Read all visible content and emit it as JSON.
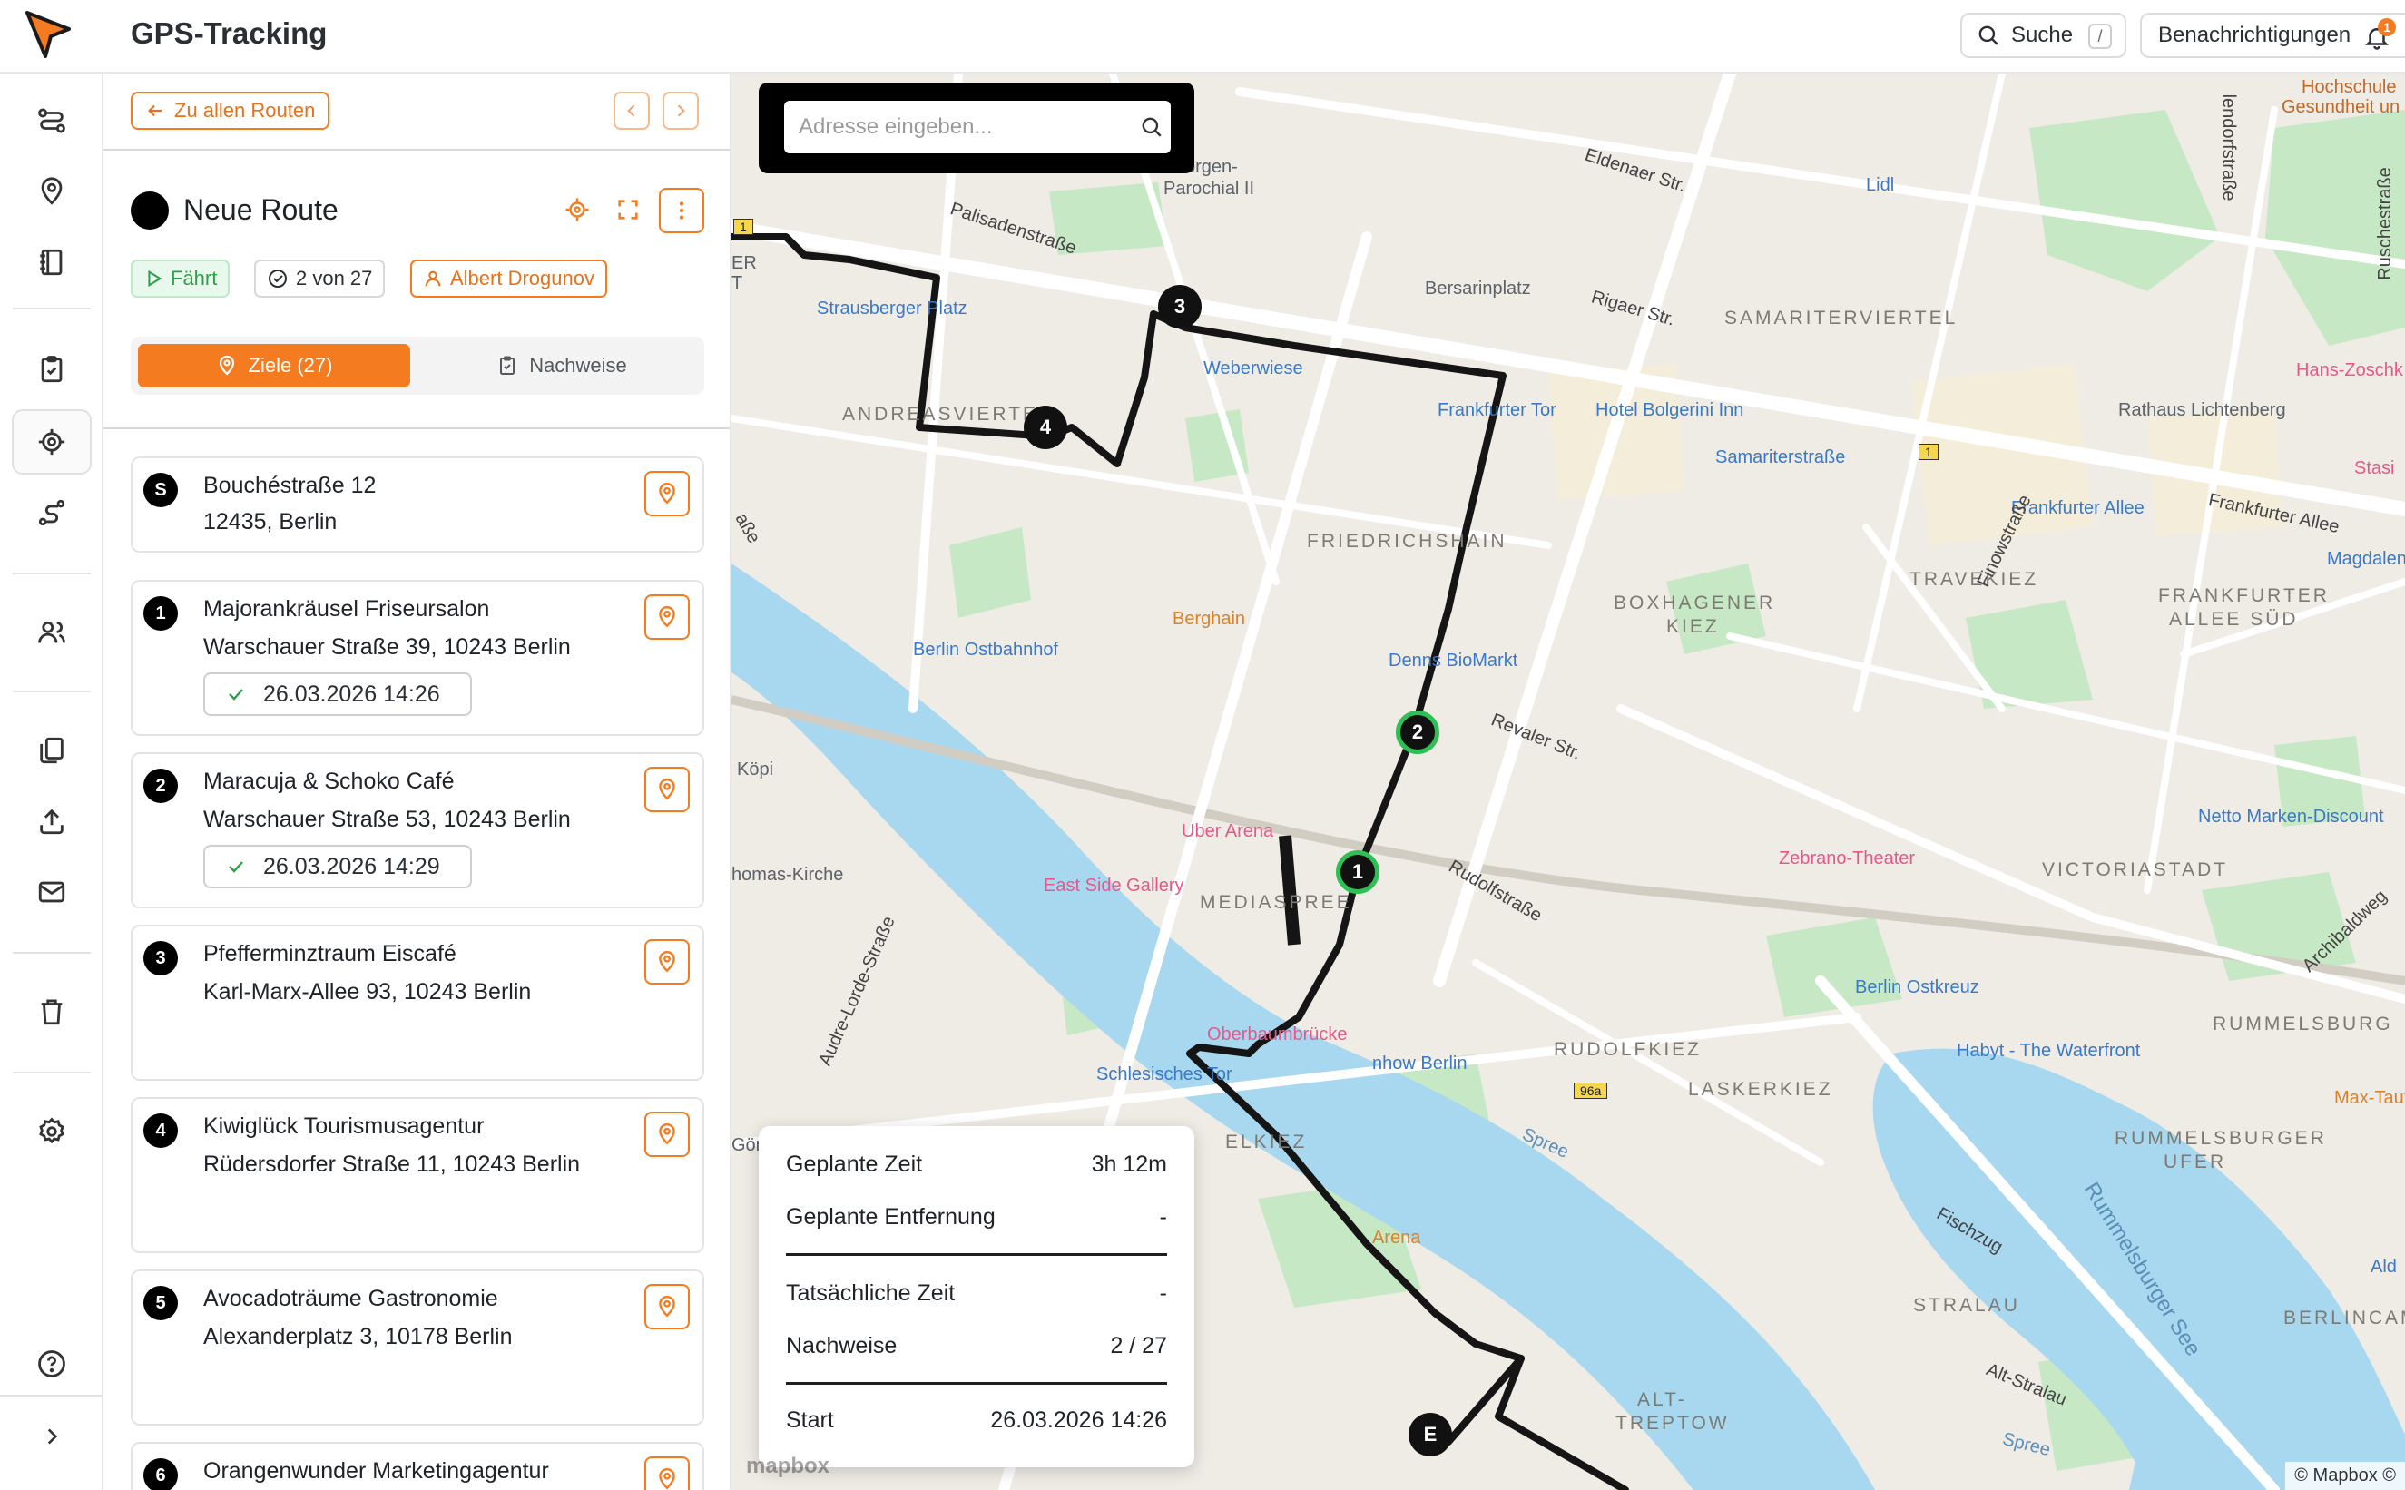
{
  "app": {
    "title": "GPS-Tracking"
  },
  "topbar": {
    "search_label": "Suche",
    "search_shortcut": "/",
    "notifications_label": "Benachrichtigungen",
    "notifications_count": "1"
  },
  "rail": {
    "icons": [
      "routes-icon",
      "location-pin-icon",
      "ledger-icon",
      "clipboard-check-icon",
      "tracking-target-icon",
      "route-path-icon",
      "users-icon",
      "documents-icon",
      "upload-icon",
      "mail-icon",
      "trash-icon",
      "settings-icon",
      "help-icon",
      "chevron-right-icon"
    ],
    "active": "tracking-target-icon"
  },
  "panel": {
    "back_label": "Zu allen Routen",
    "route_name": "Neue Route",
    "route_color": "#000000",
    "status_label": "Fährt",
    "progress_label": "2 von 27",
    "driver_label": "Albert Drogunov",
    "tab_goals": "Ziele (27)",
    "tab_proofs": "Nachweise",
    "accent_color": "#f47b20",
    "stops": [
      {
        "badge": "S",
        "name": "Bouchéstraße 12",
        "address": "12435, Berlin",
        "done": ""
      },
      {
        "badge": "1",
        "name": "Majorankräusel Friseursalon",
        "address": "Warschauer Straße 39, 10243 Berlin",
        "done": "26.03.2026 14:26"
      },
      {
        "badge": "2",
        "name": "Maracuja & Schoko Café",
        "address": "Warschauer Straße 53, 10243 Berlin",
        "done": "26.03.2026 14:29"
      },
      {
        "badge": "3",
        "name": "Pfefferminztraum Eiscafé",
        "address": "Karl-Marx-Allee 93, 10243 Berlin",
        "done": ""
      },
      {
        "badge": "4",
        "name": "Kiwiglück Tourismusagentur",
        "address": "Rüdersdorfer Straße 11, 10243 Berlin",
        "done": ""
      },
      {
        "badge": "5",
        "name": "Avocadoträume Gastronomie",
        "address": "Alexanderplatz 3, 10178 Berlin",
        "done": ""
      },
      {
        "badge": "6",
        "name": "Orangenwunder Marketingagentur",
        "address": "",
        "done": ""
      }
    ]
  },
  "map": {
    "address_placeholder": "Adresse eingeben...",
    "stats": {
      "planned_time_label": "Geplante Zeit",
      "planned_time_value": "3h 12m",
      "planned_distance_label": "Geplante Entfernung",
      "planned_distance_value": "-",
      "actual_time_label": "Tatsächliche Zeit",
      "actual_time_value": "-",
      "proofs_label": "Nachweise",
      "proofs_value": "2 / 27",
      "start_label": "Start",
      "start_value": "26.03.2026 14:26"
    },
    "waypoints": {
      "w1": "1",
      "w2": "2",
      "w3": "3",
      "w4": "4",
      "end": "E"
    },
    "attribution": "© Mapbox ©",
    "logo": "mapbox",
    "labels": {
      "eldenaer": "Eldenaer Str.",
      "palisaden": "Palisadenstraße",
      "parochial": "Parochial II",
      "morgen": "orgen-",
      "strausberger": "Strausberger Platz",
      "weberwiese": "Weberwiese",
      "bersarinplatz": "Bersarinplatz",
      "rigaer": "Rigaer Str.",
      "samariterviertel": "SAMARITERVIERTEL",
      "lidl": "Lidl",
      "frankfurter_tor": "Frankfurter Tor",
      "bolgerini": "Hotel Bolgerini Inn",
      "samariterstr": "Samariterstraße",
      "andreasviertel": "ANDREASVIERTEL",
      "friedrichshain": "FRIEDRICHSHAIN",
      "boxhagener": "BOXHAGENER",
      "boxhagener2": "KIEZ",
      "travekiez": "TRAVEKIEZ",
      "frankfurter_allee": "Frankfurter Allee",
      "frankfurter_allee_road": "Frankfurter Allee",
      "frankfurter_sued": "FRANKFURTER",
      "frankfurter_sued2": "ALLEE SÜD",
      "rathaus": "Rathaus Lichtenberg",
      "hans": "Hans-Zoschk",
      "magdalen": "Magdalen",
      "stasi": "Stasi",
      "berghain": "Berghain",
      "ostbahnhof": "Berlin Ostbahnhof",
      "denns": "Denns BioMarkt",
      "revaler": "Revaler Str.",
      "uber": "Uber Arena",
      "eastside": "East Side Gallery",
      "mediaspree": "MEDIASPREE",
      "rudolfstr": "Rudolfstraße",
      "zebrano": "Zebrano-Theater",
      "victoriastadt": "VICTORIASTADT",
      "netto": "Netto Marken-Discount",
      "ostkreuz": "Berlin Ostkreuz",
      "rummelsburg": "RUMMELSBURG",
      "habyt": "Habyt - The Waterfront",
      "maxtaut": "Max-Taut-",
      "oberbaum": "Oberbaumbrücke",
      "schlesisches": "Schlesisches Tor",
      "nhow": "nhow Berlin",
      "rudolfkiez": "RUDOLFKIEZ",
      "laskerkiez": "LASKERKIEZ",
      "rummelsburger_ufer": "RUMMELSBURGER",
      "rummelsburger_ufer2": "UFER",
      "rummelsburger_see": "Rummelsburger See",
      "fischzug": "Fischzug",
      "stralau": "STRALAU",
      "altstralau": "Alt-Stralau",
      "berlincamp": "BERLINCAMP",
      "alttreptow": "ALT-",
      "alttreptow2": "TREPTOW",
      "arena": "Arena",
      "spree": "Spree",
      "spree2": "Spree",
      "kopi": "Köpi",
      "thomas": "homas-Kirche",
      "audre": "Audre-Lorde-Straße",
      "elkiez": "ELKIEZ",
      "hochschule": "Hochschule",
      "gesundheit": "Gesundheit un",
      "finowstr": "Finowstraße",
      "archibald": "Archibaldweg",
      "ruschestr": "Ruschestraße",
      "lendorf": "lendorfstraße",
      "ald": "Ald",
      "goer": "Gör",
      "strasse": "aße",
      "er": "ER",
      "t": "T",
      "b1": "1",
      "b1b": "1",
      "b96a": "96a"
    }
  }
}
